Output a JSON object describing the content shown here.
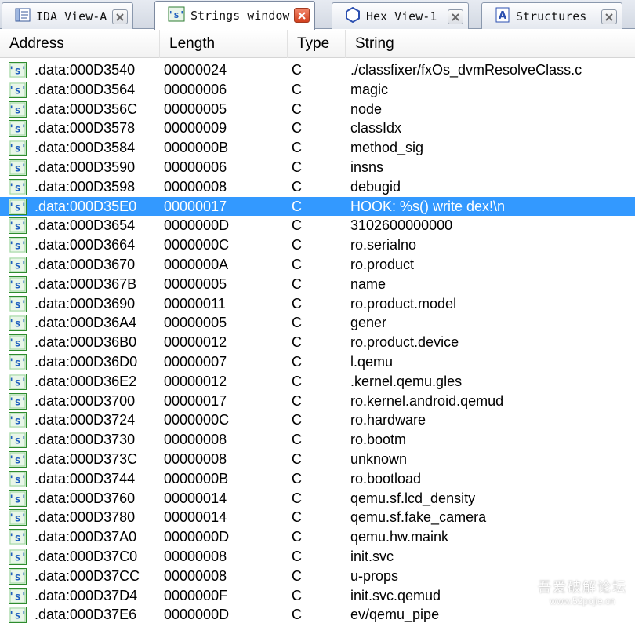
{
  "tabs": [
    {
      "label": "IDA View-A",
      "icon": "ida-view-icon",
      "active": false
    },
    {
      "label": "Strings window",
      "icon": "strings-icon",
      "active": true
    },
    {
      "label": "Hex View-1",
      "icon": "hex-view-icon",
      "active": false
    },
    {
      "label": "Structures",
      "icon": "structures-icon",
      "active": false
    }
  ],
  "table": {
    "columns": [
      "Address",
      "Length",
      "Type",
      "String"
    ],
    "rows": [
      {
        "address": ".data:000D3540",
        "length": "00000024",
        "type": "C",
        "string": "./classfixer/fxOs_dvmResolveClass.c"
      },
      {
        "address": ".data:000D3564",
        "length": "00000006",
        "type": "C",
        "string": "magic"
      },
      {
        "address": ".data:000D356C",
        "length": "00000005",
        "type": "C",
        "string": "node"
      },
      {
        "address": ".data:000D3578",
        "length": "00000009",
        "type": "C",
        "string": "classIdx"
      },
      {
        "address": ".data:000D3584",
        "length": "0000000B",
        "type": "C",
        "string": "method_sig"
      },
      {
        "address": ".data:000D3590",
        "length": "00000006",
        "type": "C",
        "string": "insns"
      },
      {
        "address": ".data:000D3598",
        "length": "00000008",
        "type": "C",
        "string": "debugid"
      },
      {
        "address": ".data:000D35E0",
        "length": "00000017",
        "type": "C",
        "string": "HOOK: %s() write dex!\\n",
        "selected": true
      },
      {
        "address": ".data:000D3654",
        "length": "0000000D",
        "type": "C",
        "string": "3102600000000"
      },
      {
        "address": ".data:000D3664",
        "length": "0000000C",
        "type": "C",
        "string": "ro.serialno"
      },
      {
        "address": ".data:000D3670",
        "length": "0000000A",
        "type": "C",
        "string": "ro.product"
      },
      {
        "address": ".data:000D367B",
        "length": "00000005",
        "type": "C",
        "string": "name"
      },
      {
        "address": ".data:000D3690",
        "length": "00000011",
        "type": "C",
        "string": "ro.product.model"
      },
      {
        "address": ".data:000D36A4",
        "length": "00000005",
        "type": "C",
        "string": "gener"
      },
      {
        "address": ".data:000D36B0",
        "length": "00000012",
        "type": "C",
        "string": "ro.product.device"
      },
      {
        "address": ".data:000D36D0",
        "length": "00000007",
        "type": "C",
        "string": "l.qemu"
      },
      {
        "address": ".data:000D36E2",
        "length": "00000012",
        "type": "C",
        "string": ".kernel.qemu.gles"
      },
      {
        "address": ".data:000D3700",
        "length": "00000017",
        "type": "C",
        "string": "ro.kernel.android.qemud"
      },
      {
        "address": ".data:000D3724",
        "length": "0000000C",
        "type": "C",
        "string": "ro.hardware"
      },
      {
        "address": ".data:000D3730",
        "length": "00000008",
        "type": "C",
        "string": "ro.bootm"
      },
      {
        "address": ".data:000D373C",
        "length": "00000008",
        "type": "C",
        "string": "unknown"
      },
      {
        "address": ".data:000D3744",
        "length": "0000000B",
        "type": "C",
        "string": "ro.bootload"
      },
      {
        "address": ".data:000D3760",
        "length": "00000014",
        "type": "C",
        "string": "qemu.sf.lcd_density"
      },
      {
        "address": ".data:000D3780",
        "length": "00000014",
        "type": "C",
        "string": "qemu.sf.fake_camera"
      },
      {
        "address": ".data:000D37A0",
        "length": "0000000D",
        "type": "C",
        "string": "qemu.hw.maink"
      },
      {
        "address": ".data:000D37C0",
        "length": "00000008",
        "type": "C",
        "string": "init.svc"
      },
      {
        "address": ".data:000D37CC",
        "length": "00000008",
        "type": "C",
        "string": "u-props"
      },
      {
        "address": ".data:000D37D4",
        "length": "0000000F",
        "type": "C",
        "string": "init.svc.qemud"
      },
      {
        "address": ".data:000D37E6",
        "length": "0000000D",
        "type": "C",
        "string": "ev/qemu_pipe"
      }
    ]
  },
  "row_icon": {
    "glyph": "'s'",
    "name": "string-icon"
  },
  "watermark": {
    "line1": "吾爱破解论坛",
    "line2": "www.52pojie.cn"
  },
  "colors": {
    "selection": "#3399ff",
    "icon_green": "#2e8b2e",
    "icon_blue": "#1f5fbf"
  }
}
